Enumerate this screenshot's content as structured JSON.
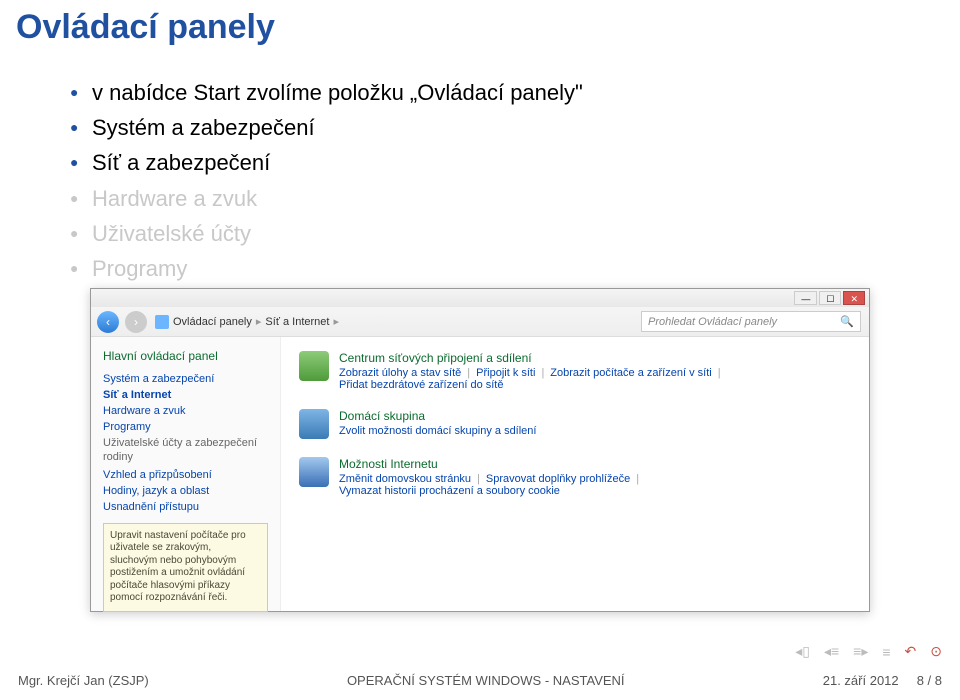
{
  "slide": {
    "title": "Ovládací panely",
    "bullets": [
      {
        "text": "v nabídce Start zvolíme položku „Ovládací panely\"",
        "class": "strong"
      },
      {
        "text": "Systém a zabezpečení",
        "class": "strong"
      },
      {
        "text": "Síť a zabezpečení",
        "class": "strong"
      },
      {
        "text": "Hardware a zvuk",
        "class": "faded"
      },
      {
        "text": "Uživatelské účty",
        "class": "faded"
      },
      {
        "text": "Programy",
        "class": "faded"
      }
    ]
  },
  "window": {
    "breadcrumb": {
      "part1": "Ovládací panely",
      "part2": "Síť a Internet"
    },
    "search_placeholder": "Prohledat Ovládací panely",
    "sidebar": {
      "heading": "Hlavní ovládací panel",
      "items": [
        {
          "label": "Systém a zabezpečení"
        },
        {
          "label": "Síť a Internet",
          "active": true
        },
        {
          "label": "Hardware a zvuk"
        },
        {
          "label": "Programy"
        },
        {
          "label": "Uživatelské účty a zabezpečení rodiny",
          "gray": true
        },
        {
          "label": "Vzhled a přizpůsobení"
        },
        {
          "label": "Hodiny, jazyk a oblast"
        },
        {
          "label": "Usnadnění přístupu"
        }
      ],
      "tooltip": "Upravit nastavení počítače pro uživatele se zrakovým, sluchovým nebo pohybovým postižením a umožnit ovládání počítače hlasovými příkazy pomocí rozpoznávání řeči."
    },
    "groups": [
      {
        "title": "Centrum síťových připojení a sdílení",
        "links": [
          "Zobrazit úlohy a stav sítě",
          "Připojit k síti",
          "Zobrazit počítače a zařízení v síti",
          "Přidat bezdrátové zařízení do sítě"
        ]
      },
      {
        "title": "Domácí skupina",
        "links": [
          "Zvolit možnosti domácí skupiny a sdílení"
        ]
      },
      {
        "title": "Možnosti Internetu",
        "links": [
          "Změnit domovskou stránku",
          "Spravovat doplňky prohlížeče",
          "Vymazat historii procházení a soubory cookie"
        ]
      }
    ]
  },
  "footer": {
    "author": "Mgr. Krejčí Jan (ZSJP)",
    "center": "OPERAČNÍ SYSTÉM WINDOWS - NASTAVENÍ",
    "date": "21. září 2012",
    "page": "8 / 8"
  }
}
